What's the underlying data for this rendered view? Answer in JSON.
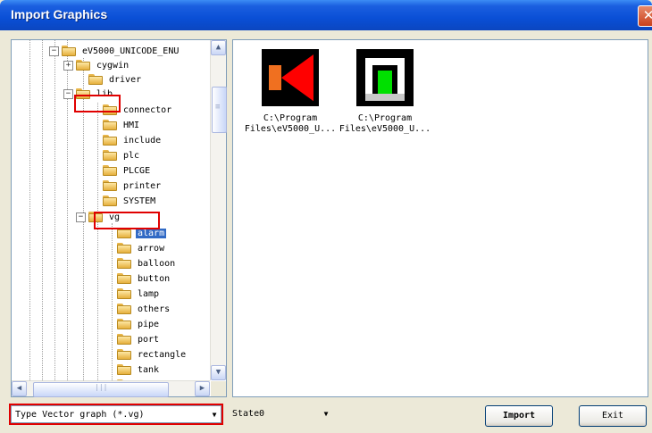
{
  "window": {
    "title": "Import Graphics",
    "close_glyph": "✕"
  },
  "tree": {
    "nodes": [
      {
        "label": "eV5000_UNICODE_ENU",
        "expander": "−"
      },
      {
        "label": "cygwin",
        "expander": "+"
      },
      {
        "label": "driver"
      },
      {
        "label": "lib",
        "expander": "−"
      },
      {
        "label": "connector"
      },
      {
        "label": "HMI"
      },
      {
        "label": "include"
      },
      {
        "label": "plc"
      },
      {
        "label": "PLCGE"
      },
      {
        "label": "printer"
      },
      {
        "label": "SYSTEM"
      },
      {
        "label": "vg",
        "expander": "−"
      },
      {
        "label": "alarm",
        "selected": true
      },
      {
        "label": "arrow"
      },
      {
        "label": "balloon"
      },
      {
        "label": "button"
      },
      {
        "label": "lamp"
      },
      {
        "label": "others"
      },
      {
        "label": "pipe"
      },
      {
        "label": "port"
      },
      {
        "label": "rectangle"
      },
      {
        "label": "tank"
      },
      {
        "label": "val"
      }
    ]
  },
  "scroll": {
    "up": "▲",
    "down": "▼",
    "left": "◀",
    "right": "▶",
    "grip_v": "≡",
    "grip_h": "|||"
  },
  "files": [
    {
      "line1": "C:\\Program",
      "line2": "Files\\eV5000_U...",
      "graphic": "horn"
    },
    {
      "line1": "C:\\Program",
      "line2": "Files\\eV5000_U...",
      "graphic": "lamp-green"
    }
  ],
  "controls": {
    "type_label": "Type",
    "type_value": "Vector graph (*.vg)",
    "state_label": "State",
    "state_value": "0",
    "import_label": "Import",
    "exit_label": "Exit",
    "dropdown_glyph": "▼"
  },
  "colors": {
    "titlebar": "#0a4fd6",
    "selection": "#316ac5",
    "highlight_box": "#e00000"
  }
}
